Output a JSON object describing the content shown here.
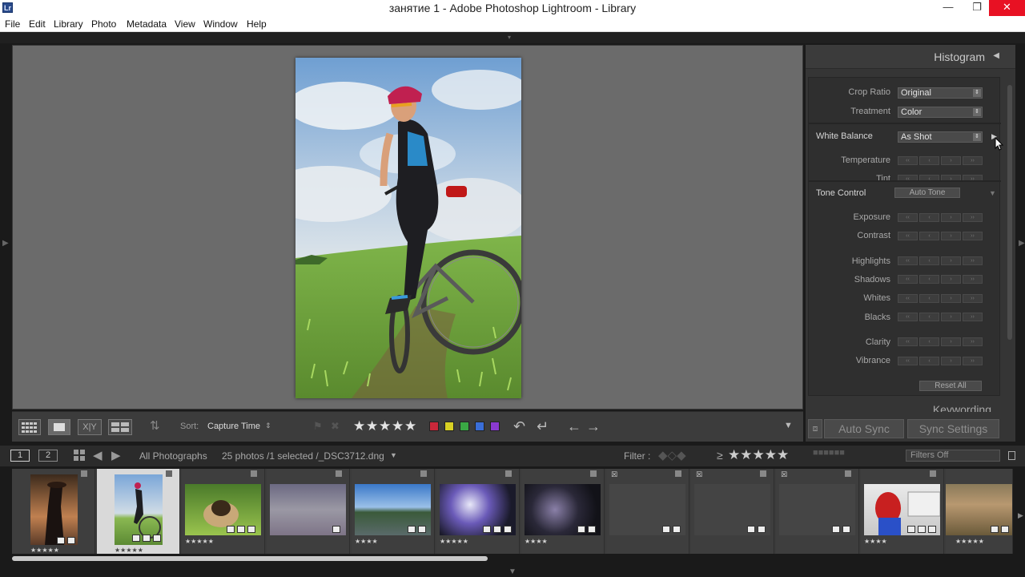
{
  "window": {
    "title": "занятие 1 - Adobe Photoshop Lightroom - Library",
    "app_icon": "Lr",
    "minimize": "—",
    "restore": "❐",
    "close": "✕"
  },
  "menu": [
    "File",
    "Edit",
    "Library",
    "Photo",
    "Metadata",
    "View",
    "Window",
    "Help"
  ],
  "toolbar": {
    "sort_label": "Sort:",
    "sort_value": "Capture Time",
    "rating_stars": 5,
    "color_labels": [
      "#c8283a",
      "#d8d024",
      "#3aa844",
      "#3a6ed8",
      "#8a3ad0"
    ]
  },
  "right_panel": {
    "histogram_title": "Histogram",
    "crop_ratio_label": "Crop Ratio",
    "crop_ratio_value": "Original",
    "treatment_label": "Treatment",
    "treatment_value": "Color",
    "white_balance_label": "White Balance",
    "white_balance_value": "As Shot",
    "temperature_label": "Temperature",
    "tint_label": "Tint",
    "tone_control_label": "Tone Control",
    "auto_tone_label": "Auto Tone",
    "exposure_label": "Exposure",
    "contrast_label": "Contrast",
    "highlights_label": "Highlights",
    "shadows_label": "Shadows",
    "whites_label": "Whites",
    "blacks_label": "Blacks",
    "clarity_label": "Clarity",
    "vibrance_label": "Vibrance",
    "reset_all_label": "Reset All",
    "keywording_title": "Keywording",
    "auto_sync_label": "Auto Sync",
    "sync_settings_label": "Sync Settings"
  },
  "filmstrip": {
    "monitor_1": "1",
    "monitor_2": "2",
    "source": "All Photographs",
    "count_text": "25 photos /1 selected /_DSC3712.dng",
    "filter_label": "Filter :",
    "filters_off": "Filters Off",
    "thumbs": [
      {
        "stars": "★★★★★"
      },
      {
        "stars": "★★★★★"
      },
      {
        "stars": "★★★★★"
      },
      {
        "stars": ""
      },
      {
        "stars": "★★★★"
      },
      {
        "stars": "★★★★★"
      },
      {
        "stars": "★★★★"
      },
      {
        "stars": ""
      },
      {
        "stars": ""
      },
      {
        "stars": ""
      },
      {
        "stars": "★★★★"
      },
      {
        "stars": "★★★★★"
      }
    ]
  }
}
